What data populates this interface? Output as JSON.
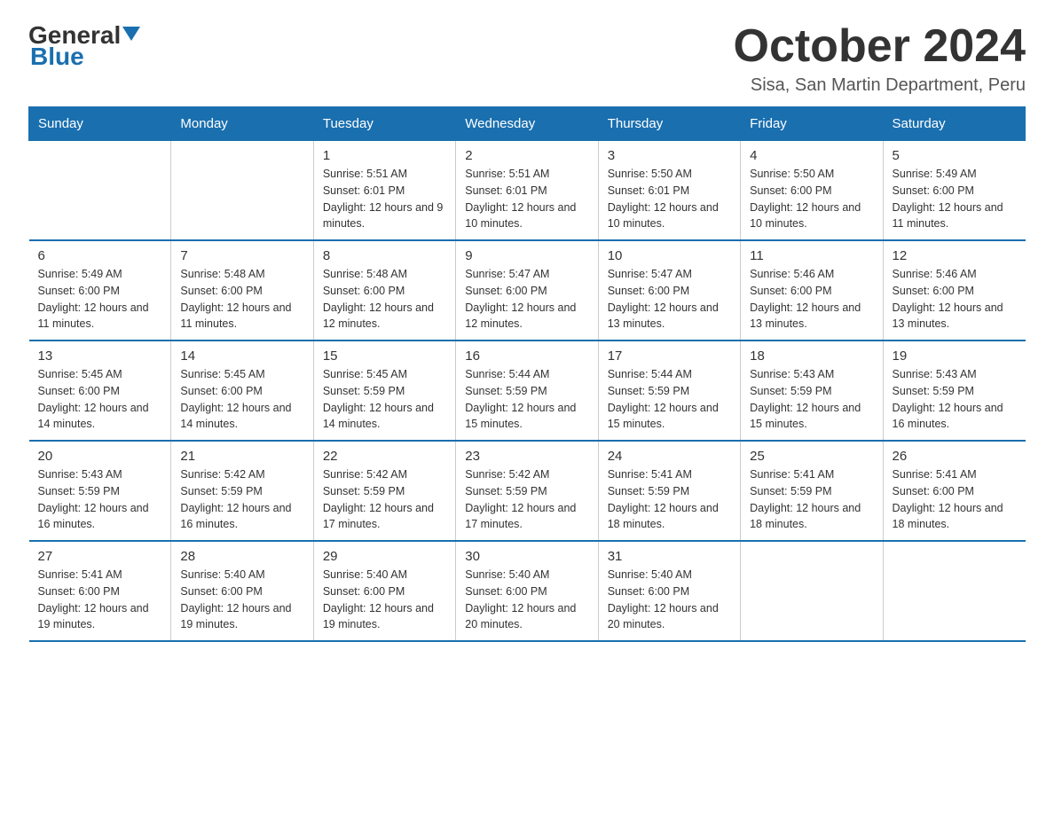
{
  "logo": {
    "general": "General",
    "blue": "Blue"
  },
  "title": "October 2024",
  "subtitle": "Sisa, San Martin Department, Peru",
  "days_of_week": [
    "Sunday",
    "Monday",
    "Tuesday",
    "Wednesday",
    "Thursday",
    "Friday",
    "Saturday"
  ],
  "weeks": [
    [
      {
        "day": "",
        "sunrise": "",
        "sunset": "",
        "daylight": ""
      },
      {
        "day": "",
        "sunrise": "",
        "sunset": "",
        "daylight": ""
      },
      {
        "day": "1",
        "sunrise": "Sunrise: 5:51 AM",
        "sunset": "Sunset: 6:01 PM",
        "daylight": "Daylight: 12 hours and 9 minutes."
      },
      {
        "day": "2",
        "sunrise": "Sunrise: 5:51 AM",
        "sunset": "Sunset: 6:01 PM",
        "daylight": "Daylight: 12 hours and 10 minutes."
      },
      {
        "day": "3",
        "sunrise": "Sunrise: 5:50 AM",
        "sunset": "Sunset: 6:01 PM",
        "daylight": "Daylight: 12 hours and 10 minutes."
      },
      {
        "day": "4",
        "sunrise": "Sunrise: 5:50 AM",
        "sunset": "Sunset: 6:00 PM",
        "daylight": "Daylight: 12 hours and 10 minutes."
      },
      {
        "day": "5",
        "sunrise": "Sunrise: 5:49 AM",
        "sunset": "Sunset: 6:00 PM",
        "daylight": "Daylight: 12 hours and 11 minutes."
      }
    ],
    [
      {
        "day": "6",
        "sunrise": "Sunrise: 5:49 AM",
        "sunset": "Sunset: 6:00 PM",
        "daylight": "Daylight: 12 hours and 11 minutes."
      },
      {
        "day": "7",
        "sunrise": "Sunrise: 5:48 AM",
        "sunset": "Sunset: 6:00 PM",
        "daylight": "Daylight: 12 hours and 11 minutes."
      },
      {
        "day": "8",
        "sunrise": "Sunrise: 5:48 AM",
        "sunset": "Sunset: 6:00 PM",
        "daylight": "Daylight: 12 hours and 12 minutes."
      },
      {
        "day": "9",
        "sunrise": "Sunrise: 5:47 AM",
        "sunset": "Sunset: 6:00 PM",
        "daylight": "Daylight: 12 hours and 12 minutes."
      },
      {
        "day": "10",
        "sunrise": "Sunrise: 5:47 AM",
        "sunset": "Sunset: 6:00 PM",
        "daylight": "Daylight: 12 hours and 13 minutes."
      },
      {
        "day": "11",
        "sunrise": "Sunrise: 5:46 AM",
        "sunset": "Sunset: 6:00 PM",
        "daylight": "Daylight: 12 hours and 13 minutes."
      },
      {
        "day": "12",
        "sunrise": "Sunrise: 5:46 AM",
        "sunset": "Sunset: 6:00 PM",
        "daylight": "Daylight: 12 hours and 13 minutes."
      }
    ],
    [
      {
        "day": "13",
        "sunrise": "Sunrise: 5:45 AM",
        "sunset": "Sunset: 6:00 PM",
        "daylight": "Daylight: 12 hours and 14 minutes."
      },
      {
        "day": "14",
        "sunrise": "Sunrise: 5:45 AM",
        "sunset": "Sunset: 6:00 PM",
        "daylight": "Daylight: 12 hours and 14 minutes."
      },
      {
        "day": "15",
        "sunrise": "Sunrise: 5:45 AM",
        "sunset": "Sunset: 5:59 PM",
        "daylight": "Daylight: 12 hours and 14 minutes."
      },
      {
        "day": "16",
        "sunrise": "Sunrise: 5:44 AM",
        "sunset": "Sunset: 5:59 PM",
        "daylight": "Daylight: 12 hours and 15 minutes."
      },
      {
        "day": "17",
        "sunrise": "Sunrise: 5:44 AM",
        "sunset": "Sunset: 5:59 PM",
        "daylight": "Daylight: 12 hours and 15 minutes."
      },
      {
        "day": "18",
        "sunrise": "Sunrise: 5:43 AM",
        "sunset": "Sunset: 5:59 PM",
        "daylight": "Daylight: 12 hours and 15 minutes."
      },
      {
        "day": "19",
        "sunrise": "Sunrise: 5:43 AM",
        "sunset": "Sunset: 5:59 PM",
        "daylight": "Daylight: 12 hours and 16 minutes."
      }
    ],
    [
      {
        "day": "20",
        "sunrise": "Sunrise: 5:43 AM",
        "sunset": "Sunset: 5:59 PM",
        "daylight": "Daylight: 12 hours and 16 minutes."
      },
      {
        "day": "21",
        "sunrise": "Sunrise: 5:42 AM",
        "sunset": "Sunset: 5:59 PM",
        "daylight": "Daylight: 12 hours and 16 minutes."
      },
      {
        "day": "22",
        "sunrise": "Sunrise: 5:42 AM",
        "sunset": "Sunset: 5:59 PM",
        "daylight": "Daylight: 12 hours and 17 minutes."
      },
      {
        "day": "23",
        "sunrise": "Sunrise: 5:42 AM",
        "sunset": "Sunset: 5:59 PM",
        "daylight": "Daylight: 12 hours and 17 minutes."
      },
      {
        "day": "24",
        "sunrise": "Sunrise: 5:41 AM",
        "sunset": "Sunset: 5:59 PM",
        "daylight": "Daylight: 12 hours and 18 minutes."
      },
      {
        "day": "25",
        "sunrise": "Sunrise: 5:41 AM",
        "sunset": "Sunset: 5:59 PM",
        "daylight": "Daylight: 12 hours and 18 minutes."
      },
      {
        "day": "26",
        "sunrise": "Sunrise: 5:41 AM",
        "sunset": "Sunset: 6:00 PM",
        "daylight": "Daylight: 12 hours and 18 minutes."
      }
    ],
    [
      {
        "day": "27",
        "sunrise": "Sunrise: 5:41 AM",
        "sunset": "Sunset: 6:00 PM",
        "daylight": "Daylight: 12 hours and 19 minutes."
      },
      {
        "day": "28",
        "sunrise": "Sunrise: 5:40 AM",
        "sunset": "Sunset: 6:00 PM",
        "daylight": "Daylight: 12 hours and 19 minutes."
      },
      {
        "day": "29",
        "sunrise": "Sunrise: 5:40 AM",
        "sunset": "Sunset: 6:00 PM",
        "daylight": "Daylight: 12 hours and 19 minutes."
      },
      {
        "day": "30",
        "sunrise": "Sunrise: 5:40 AM",
        "sunset": "Sunset: 6:00 PM",
        "daylight": "Daylight: 12 hours and 20 minutes."
      },
      {
        "day": "31",
        "sunrise": "Sunrise: 5:40 AM",
        "sunset": "Sunset: 6:00 PM",
        "daylight": "Daylight: 12 hours and 20 minutes."
      },
      {
        "day": "",
        "sunrise": "",
        "sunset": "",
        "daylight": ""
      },
      {
        "day": "",
        "sunrise": "",
        "sunset": "",
        "daylight": ""
      }
    ]
  ]
}
